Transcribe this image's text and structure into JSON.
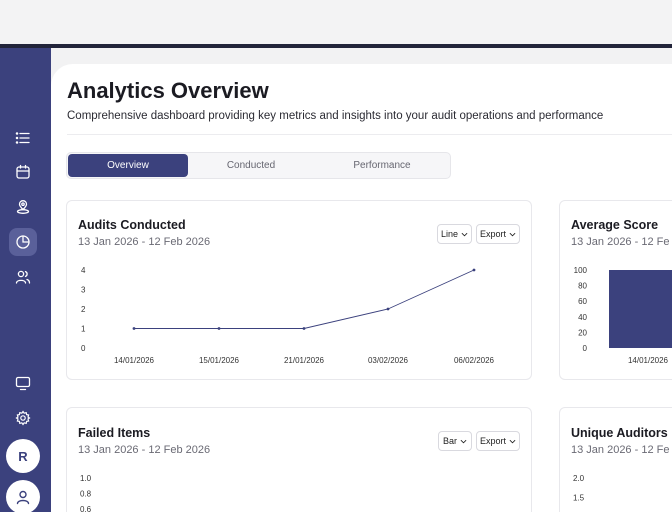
{
  "header": {
    "title": "Analytics Overview",
    "subtitle": "Comprehensive dashboard providing key metrics and insights into your audit operations and performance"
  },
  "tabs": [
    {
      "label": "Overview",
      "active": true
    },
    {
      "label": "Conducted",
      "active": false
    },
    {
      "label": "Performance",
      "active": false
    }
  ],
  "sidebar": {
    "items": [
      {
        "icon": "list-icon",
        "active": false
      },
      {
        "icon": "calendar-icon",
        "active": false
      },
      {
        "icon": "location-pin-icon",
        "active": false
      },
      {
        "icon": "pie-chart-icon",
        "active": true
      },
      {
        "icon": "users-icon",
        "active": false
      }
    ],
    "bottom_items": [
      {
        "icon": "monitor-icon"
      },
      {
        "icon": "settings-gear-icon"
      }
    ],
    "avatar_initial": "R",
    "accent_color": "#3b417d"
  },
  "cards": {
    "audits_conducted": {
      "title": "Audits Conducted",
      "range": "13 Jan 2026 - 12 Feb 2026",
      "chart_type_label": "Line",
      "export_label": "Export"
    },
    "average_score": {
      "title": "Average Score",
      "range": "13 Jan 2026 - 12 Fe"
    },
    "failed_items": {
      "title": "Failed Items",
      "range": "13 Jan 2026 - 12 Feb 2026",
      "chart_type_label": "Bar",
      "export_label": "Export"
    },
    "unique_auditors": {
      "title": "Unique Auditors",
      "range": "13 Jan 2026 - 12 Fe"
    }
  },
  "chart_data": [
    {
      "type": "line",
      "x": [
        "14/01/2026",
        "15/01/2026",
        "21/01/2026",
        "03/02/2026",
        "06/02/2026"
      ],
      "values": [
        1,
        1,
        1,
        2,
        4
      ],
      "ylim": [
        0,
        4
      ],
      "yticks": [
        0,
        1,
        2,
        3,
        4
      ],
      "color": "#3b417d"
    },
    {
      "type": "bar",
      "categories": [
        "14/01/2026"
      ],
      "values": [
        100
      ],
      "ylim": [
        0,
        100
      ],
      "yticks": [
        0,
        20,
        40,
        60,
        80,
        100
      ],
      "color": "#3b417d"
    },
    {
      "type": "bar",
      "yticks_visible": [
        "1.0",
        "0.8",
        "0.6"
      ]
    },
    {
      "type": "line",
      "yticks_visible": [
        "2.0",
        "1.5"
      ]
    }
  ]
}
